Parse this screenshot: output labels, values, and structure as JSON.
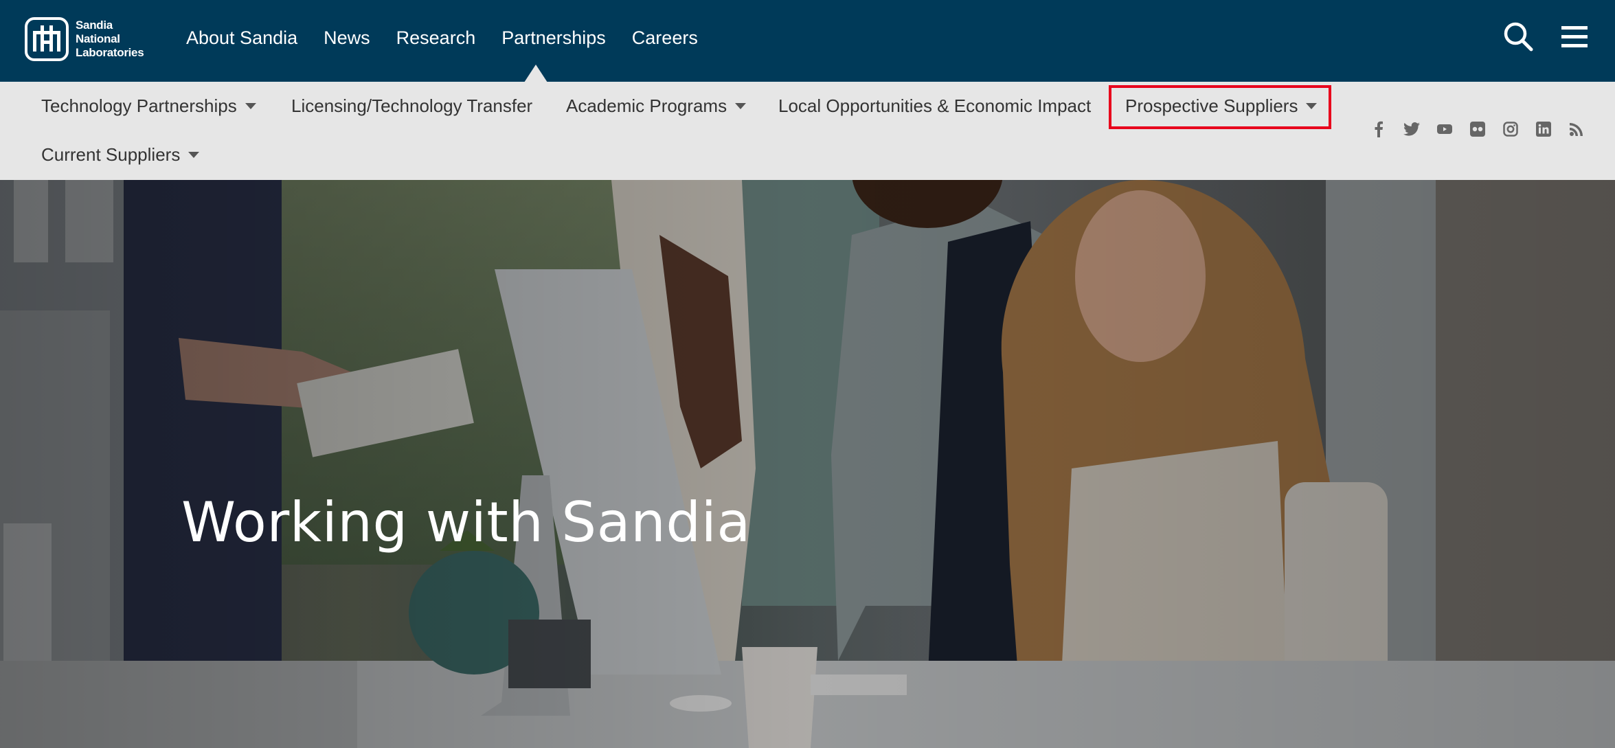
{
  "header": {
    "logo_lines": [
      "Sandia",
      "National",
      "Laboratories"
    ],
    "nav": [
      "About Sandia",
      "News",
      "Research",
      "Partnerships",
      "Careers"
    ],
    "icons": [
      "search-icon",
      "menu-icon"
    ]
  },
  "subnav": {
    "items": [
      {
        "label": "Technology Partnerships",
        "dropdown": true
      },
      {
        "label": "Licensing/Technology Transfer",
        "dropdown": false
      },
      {
        "label": "Academic Programs",
        "dropdown": true
      },
      {
        "label": "Local Opportunities & Economic Impact",
        "dropdown": false
      },
      {
        "label": "Prospective Suppliers",
        "dropdown": true
      },
      {
        "label": "Current Suppliers",
        "dropdown": true
      }
    ],
    "social_icons": [
      "facebook-icon",
      "twitter-icon",
      "youtube-icon",
      "flickr-icon",
      "instagram-icon",
      "linkedin-icon",
      "rss-icon"
    ]
  },
  "hero": {
    "title": "Working with Sandia"
  },
  "colors": {
    "header_bg": "#003a59",
    "subnav_bg": "#e6e6e6",
    "highlight": "#e8001c"
  }
}
